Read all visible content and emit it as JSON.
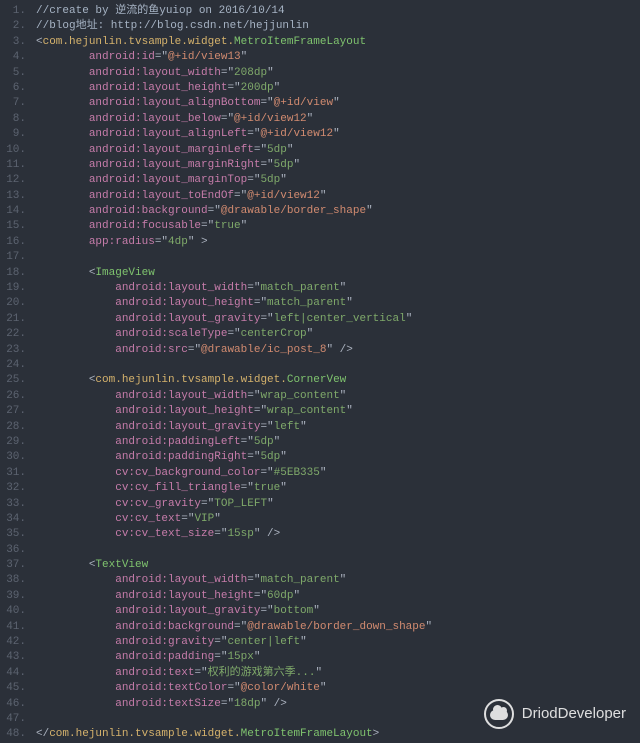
{
  "line_count": 48,
  "lines": [
    {
      "indent": 0,
      "tokens": [
        {
          "t": "//create by 逆流的鱼yuiop on 2016/10/14",
          "c": "c-comment"
        }
      ]
    },
    {
      "indent": 0,
      "tokens": [
        {
          "t": "//blog地址: http://blog.csdn.net/hejjunlin",
          "c": "c-comment"
        }
      ]
    },
    {
      "indent": 0,
      "tokens": [
        {
          "t": "<",
          "c": "c-punct"
        },
        {
          "t": "com.hejunlin.tvsample.widget.",
          "c": "c-tag"
        },
        {
          "t": "MetroItemFrameLayout",
          "c": "c-tagclass"
        }
      ]
    },
    {
      "indent": 2,
      "tokens": [
        {
          "t": "android:id",
          "c": "c-attr"
        },
        {
          "t": "=\"",
          "c": "c-punct"
        },
        {
          "t": "@+id/view13",
          "c": "c-res"
        },
        {
          "t": "\"",
          "c": "c-punct"
        }
      ]
    },
    {
      "indent": 2,
      "tokens": [
        {
          "t": "android:layout_width",
          "c": "c-attr"
        },
        {
          "t": "=\"",
          "c": "c-punct"
        },
        {
          "t": "208dp",
          "c": "c-str"
        },
        {
          "t": "\"",
          "c": "c-punct"
        }
      ]
    },
    {
      "indent": 2,
      "tokens": [
        {
          "t": "android:layout_height",
          "c": "c-attr"
        },
        {
          "t": "=\"",
          "c": "c-punct"
        },
        {
          "t": "200dp",
          "c": "c-str"
        },
        {
          "t": "\"",
          "c": "c-punct"
        }
      ]
    },
    {
      "indent": 2,
      "tokens": [
        {
          "t": "android:layout_alignBottom",
          "c": "c-attr"
        },
        {
          "t": "=\"",
          "c": "c-punct"
        },
        {
          "t": "@+id/view",
          "c": "c-res"
        },
        {
          "t": "\"",
          "c": "c-punct"
        }
      ]
    },
    {
      "indent": 2,
      "tokens": [
        {
          "t": "android:layout_below",
          "c": "c-attr"
        },
        {
          "t": "=\"",
          "c": "c-punct"
        },
        {
          "t": "@+id/view12",
          "c": "c-res"
        },
        {
          "t": "\"",
          "c": "c-punct"
        }
      ]
    },
    {
      "indent": 2,
      "tokens": [
        {
          "t": "android:layout_alignLeft",
          "c": "c-attr"
        },
        {
          "t": "=\"",
          "c": "c-punct"
        },
        {
          "t": "@+id/view12",
          "c": "c-res"
        },
        {
          "t": "\"",
          "c": "c-punct"
        }
      ]
    },
    {
      "indent": 2,
      "tokens": [
        {
          "t": "android:layout_marginLeft",
          "c": "c-attr"
        },
        {
          "t": "=\"",
          "c": "c-punct"
        },
        {
          "t": "5dp",
          "c": "c-str"
        },
        {
          "t": "\"",
          "c": "c-punct"
        }
      ]
    },
    {
      "indent": 2,
      "tokens": [
        {
          "t": "android:layout_marginRight",
          "c": "c-attr"
        },
        {
          "t": "=\"",
          "c": "c-punct"
        },
        {
          "t": "5dp",
          "c": "c-str"
        },
        {
          "t": "\"",
          "c": "c-punct"
        }
      ]
    },
    {
      "indent": 2,
      "tokens": [
        {
          "t": "android:layout_marginTop",
          "c": "c-attr"
        },
        {
          "t": "=\"",
          "c": "c-punct"
        },
        {
          "t": "5dp",
          "c": "c-str"
        },
        {
          "t": "\"",
          "c": "c-punct"
        }
      ]
    },
    {
      "indent": 2,
      "tokens": [
        {
          "t": "android:layout_toEndOf",
          "c": "c-attr"
        },
        {
          "t": "=\"",
          "c": "c-punct"
        },
        {
          "t": "@+id/view12",
          "c": "c-res"
        },
        {
          "t": "\"",
          "c": "c-punct"
        }
      ]
    },
    {
      "indent": 2,
      "tokens": [
        {
          "t": "android:background",
          "c": "c-attr"
        },
        {
          "t": "=\"",
          "c": "c-punct"
        },
        {
          "t": "@drawable/border_shape",
          "c": "c-res"
        },
        {
          "t": "\"",
          "c": "c-punct"
        }
      ]
    },
    {
      "indent": 2,
      "tokens": [
        {
          "t": "android:focusable",
          "c": "c-attr"
        },
        {
          "t": "=\"",
          "c": "c-punct"
        },
        {
          "t": "true",
          "c": "c-str"
        },
        {
          "t": "\"",
          "c": "c-punct"
        }
      ]
    },
    {
      "indent": 2,
      "tokens": [
        {
          "t": "app:radius",
          "c": "c-attr"
        },
        {
          "t": "=\"",
          "c": "c-punct"
        },
        {
          "t": "4dp",
          "c": "c-str"
        },
        {
          "t": "\" >",
          "c": "c-punct"
        }
      ]
    },
    {
      "indent": 0,
      "tokens": []
    },
    {
      "indent": 2,
      "tokens": [
        {
          "t": "<",
          "c": "c-punct"
        },
        {
          "t": "ImageView",
          "c": "c-tagclass"
        }
      ]
    },
    {
      "indent": 3,
      "tokens": [
        {
          "t": "android:layout_width",
          "c": "c-attr"
        },
        {
          "t": "=\"",
          "c": "c-punct"
        },
        {
          "t": "match_parent",
          "c": "c-str"
        },
        {
          "t": "\"",
          "c": "c-punct"
        }
      ]
    },
    {
      "indent": 3,
      "tokens": [
        {
          "t": "android:layout_height",
          "c": "c-attr"
        },
        {
          "t": "=\"",
          "c": "c-punct"
        },
        {
          "t": "match_parent",
          "c": "c-str"
        },
        {
          "t": "\"",
          "c": "c-punct"
        }
      ]
    },
    {
      "indent": 3,
      "tokens": [
        {
          "t": "android:layout_gravity",
          "c": "c-attr"
        },
        {
          "t": "=\"",
          "c": "c-punct"
        },
        {
          "t": "left|center_vertical",
          "c": "c-str"
        },
        {
          "t": "\"",
          "c": "c-punct"
        }
      ]
    },
    {
      "indent": 3,
      "tokens": [
        {
          "t": "android:scaleType",
          "c": "c-attr"
        },
        {
          "t": "=\"",
          "c": "c-punct"
        },
        {
          "t": "centerCrop",
          "c": "c-str"
        },
        {
          "t": "\"",
          "c": "c-punct"
        }
      ]
    },
    {
      "indent": 3,
      "tokens": [
        {
          "t": "android:src",
          "c": "c-attr"
        },
        {
          "t": "=\"",
          "c": "c-punct"
        },
        {
          "t": "@drawable/ic_post_8",
          "c": "c-res"
        },
        {
          "t": "\" />",
          "c": "c-punct"
        }
      ]
    },
    {
      "indent": 0,
      "tokens": []
    },
    {
      "indent": 2,
      "tokens": [
        {
          "t": "<",
          "c": "c-punct"
        },
        {
          "t": "com.hejunlin.tvsample.widget.",
          "c": "c-tag"
        },
        {
          "t": "CornerVew",
          "c": "c-tagclass"
        }
      ]
    },
    {
      "indent": 3,
      "tokens": [
        {
          "t": "android:layout_width",
          "c": "c-attr"
        },
        {
          "t": "=\"",
          "c": "c-punct"
        },
        {
          "t": "wrap_content",
          "c": "c-str"
        },
        {
          "t": "\"",
          "c": "c-punct"
        }
      ]
    },
    {
      "indent": 3,
      "tokens": [
        {
          "t": "android:layout_height",
          "c": "c-attr"
        },
        {
          "t": "=\"",
          "c": "c-punct"
        },
        {
          "t": "wrap_content",
          "c": "c-str"
        },
        {
          "t": "\"",
          "c": "c-punct"
        }
      ]
    },
    {
      "indent": 3,
      "tokens": [
        {
          "t": "android:layout_gravity",
          "c": "c-attr"
        },
        {
          "t": "=\"",
          "c": "c-punct"
        },
        {
          "t": "left",
          "c": "c-str"
        },
        {
          "t": "\"",
          "c": "c-punct"
        }
      ]
    },
    {
      "indent": 3,
      "tokens": [
        {
          "t": "android:paddingLeft",
          "c": "c-attr"
        },
        {
          "t": "=\"",
          "c": "c-punct"
        },
        {
          "t": "5dp",
          "c": "c-str"
        },
        {
          "t": "\"",
          "c": "c-punct"
        }
      ]
    },
    {
      "indent": 3,
      "tokens": [
        {
          "t": "android:paddingRight",
          "c": "c-attr"
        },
        {
          "t": "=\"",
          "c": "c-punct"
        },
        {
          "t": "5dp",
          "c": "c-str"
        },
        {
          "t": "\"",
          "c": "c-punct"
        }
      ]
    },
    {
      "indent": 3,
      "tokens": [
        {
          "t": "cv:cv_background_color",
          "c": "c-attr"
        },
        {
          "t": "=\"",
          "c": "c-punct"
        },
        {
          "t": "#5EB335",
          "c": "c-str"
        },
        {
          "t": "\"",
          "c": "c-punct"
        }
      ]
    },
    {
      "indent": 3,
      "tokens": [
        {
          "t": "cv:cv_fill_triangle",
          "c": "c-attr"
        },
        {
          "t": "=\"",
          "c": "c-punct"
        },
        {
          "t": "true",
          "c": "c-str"
        },
        {
          "t": "\"",
          "c": "c-punct"
        }
      ]
    },
    {
      "indent": 3,
      "tokens": [
        {
          "t": "cv:cv_gravity",
          "c": "c-attr"
        },
        {
          "t": "=\"",
          "c": "c-punct"
        },
        {
          "t": "TOP_LEFT",
          "c": "c-str"
        },
        {
          "t": "\"",
          "c": "c-punct"
        }
      ]
    },
    {
      "indent": 3,
      "tokens": [
        {
          "t": "cv:cv_text",
          "c": "c-attr"
        },
        {
          "t": "=\"",
          "c": "c-punct"
        },
        {
          "t": "VIP",
          "c": "c-str"
        },
        {
          "t": "\"",
          "c": "c-punct"
        }
      ]
    },
    {
      "indent": 3,
      "tokens": [
        {
          "t": "cv:cv_text_size",
          "c": "c-attr"
        },
        {
          "t": "=\"",
          "c": "c-punct"
        },
        {
          "t": "15sp",
          "c": "c-str"
        },
        {
          "t": "\" />",
          "c": "c-punct"
        }
      ]
    },
    {
      "indent": 0,
      "tokens": []
    },
    {
      "indent": 2,
      "tokens": [
        {
          "t": "<",
          "c": "c-punct"
        },
        {
          "t": "TextView",
          "c": "c-tagclass"
        }
      ]
    },
    {
      "indent": 3,
      "tokens": [
        {
          "t": "android:layout_width",
          "c": "c-attr"
        },
        {
          "t": "=\"",
          "c": "c-punct"
        },
        {
          "t": "match_parent",
          "c": "c-str"
        },
        {
          "t": "\"",
          "c": "c-punct"
        }
      ]
    },
    {
      "indent": 3,
      "tokens": [
        {
          "t": "android:layout_height",
          "c": "c-attr"
        },
        {
          "t": "=\"",
          "c": "c-punct"
        },
        {
          "t": "60dp",
          "c": "c-str"
        },
        {
          "t": "\"",
          "c": "c-punct"
        }
      ]
    },
    {
      "indent": 3,
      "tokens": [
        {
          "t": "android:layout_gravity",
          "c": "c-attr"
        },
        {
          "t": "=\"",
          "c": "c-punct"
        },
        {
          "t": "bottom",
          "c": "c-str"
        },
        {
          "t": "\"",
          "c": "c-punct"
        }
      ]
    },
    {
      "indent": 3,
      "tokens": [
        {
          "t": "android:background",
          "c": "c-attr"
        },
        {
          "t": "=\"",
          "c": "c-punct"
        },
        {
          "t": "@drawable/border_down_shape",
          "c": "c-res"
        },
        {
          "t": "\"",
          "c": "c-punct"
        }
      ]
    },
    {
      "indent": 3,
      "tokens": [
        {
          "t": "android:gravity",
          "c": "c-attr"
        },
        {
          "t": "=\"",
          "c": "c-punct"
        },
        {
          "t": "center|left",
          "c": "c-str"
        },
        {
          "t": "\"",
          "c": "c-punct"
        }
      ]
    },
    {
      "indent": 3,
      "tokens": [
        {
          "t": "android:padding",
          "c": "c-attr"
        },
        {
          "t": "=\"",
          "c": "c-punct"
        },
        {
          "t": "15px",
          "c": "c-str"
        },
        {
          "t": "\"",
          "c": "c-punct"
        }
      ]
    },
    {
      "indent": 3,
      "tokens": [
        {
          "t": "android:text",
          "c": "c-attr"
        },
        {
          "t": "=\"",
          "c": "c-punct"
        },
        {
          "t": "权利的游戏第六季...",
          "c": "c-str"
        },
        {
          "t": "\"",
          "c": "c-punct"
        }
      ]
    },
    {
      "indent": 3,
      "tokens": [
        {
          "t": "android:textColor",
          "c": "c-attr"
        },
        {
          "t": "=\"",
          "c": "c-punct"
        },
        {
          "t": "@color/white",
          "c": "c-res"
        },
        {
          "t": "\"",
          "c": "c-punct"
        }
      ]
    },
    {
      "indent": 3,
      "tokens": [
        {
          "t": "android:textSize",
          "c": "c-attr"
        },
        {
          "t": "=\"",
          "c": "c-punct"
        },
        {
          "t": "18dp",
          "c": "c-str"
        },
        {
          "t": "\" />",
          "c": "c-punct"
        }
      ]
    },
    {
      "indent": 0,
      "tokens": []
    },
    {
      "indent": 0,
      "tokens": [
        {
          "t": "</",
          "c": "c-punct"
        },
        {
          "t": "com.hejunlin.tvsample.widget.",
          "c": "c-tag"
        },
        {
          "t": "MetroItemFrameLayout",
          "c": "c-tagclass"
        },
        {
          "t": ">",
          "c": "c-punct"
        }
      ]
    }
  ],
  "watermark_text": "DriodDeveloper",
  "indent_unit": "    "
}
